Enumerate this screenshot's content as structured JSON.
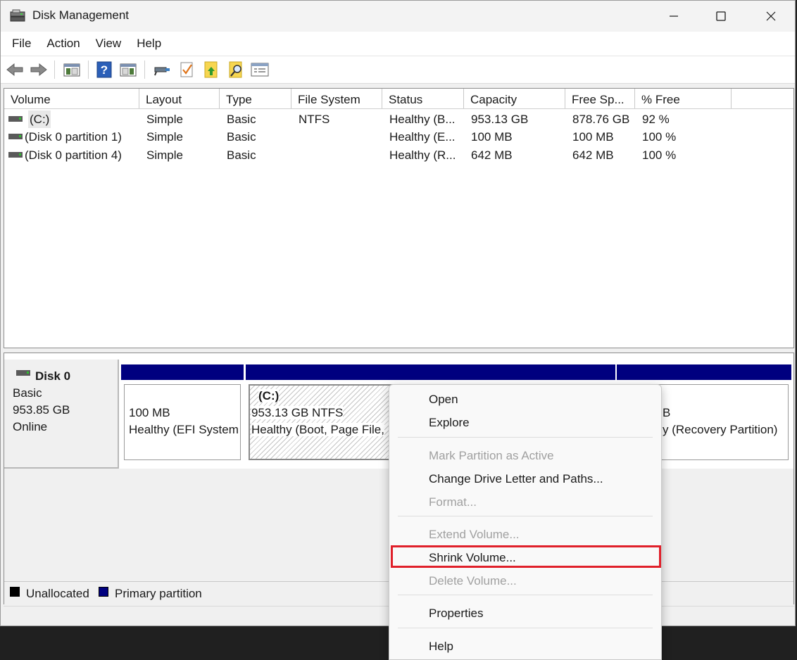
{
  "window": {
    "title": "Disk Management",
    "icon": "disk-management-icon"
  },
  "menu": [
    "File",
    "Action",
    "View",
    "Help"
  ],
  "toolbar": [
    "back-icon",
    "forward-icon",
    "show-hide-console-tree-icon",
    "help-icon",
    "action-pane-icon",
    "connect-icon",
    "checklist-icon",
    "folder-up-icon",
    "search-folder-icon",
    "properties-list-icon"
  ],
  "columns": [
    "Volume",
    "Layout",
    "Type",
    "File System",
    "Status",
    "Capacity",
    "Free Sp...",
    "% Free"
  ],
  "volumes": [
    {
      "volume": "(C:)",
      "layout": "Simple",
      "type": "Basic",
      "fs": "NTFS",
      "status": "Healthy (B...",
      "capacity": "953.13 GB",
      "free": "878.76 GB",
      "pct": "92 %"
    },
    {
      "volume": "(Disk 0 partition 1)",
      "layout": "Simple",
      "type": "Basic",
      "fs": "",
      "status": "Healthy (E...",
      "capacity": "100 MB",
      "free": "100 MB",
      "pct": "100 %"
    },
    {
      "volume": "(Disk 0 partition 4)",
      "layout": "Simple",
      "type": "Basic",
      "fs": "",
      "status": "Healthy (R...",
      "capacity": "642 MB",
      "free": "642 MB",
      "pct": "100 %"
    }
  ],
  "disk": {
    "name": "Disk 0",
    "type": "Basic",
    "size": "953.85 GB",
    "state": "Online"
  },
  "partitions": {
    "efi": {
      "size": "100 MB",
      "status": "Healthy (EFI System"
    },
    "c": {
      "letter": "(C:)",
      "size": "953.13 GB NTFS",
      "status": "Healthy (Boot, Page File,"
    },
    "recovery": {
      "size": "B",
      "status": "y (Recovery Partition)"
    }
  },
  "legend": {
    "unallocated": "Unallocated",
    "primary": "Primary partition",
    "unallocated_color": "#000000",
    "primary_color": "#00007f"
  },
  "context_menu": {
    "open": "Open",
    "explore": "Explore",
    "mark_active": "Mark Partition as Active",
    "change_letter": "Change Drive Letter and Paths...",
    "format": "Format...",
    "extend": "Extend Volume...",
    "shrink": "Shrink Volume...",
    "delete": "Delete Volume...",
    "properties": "Properties",
    "help": "Help"
  }
}
